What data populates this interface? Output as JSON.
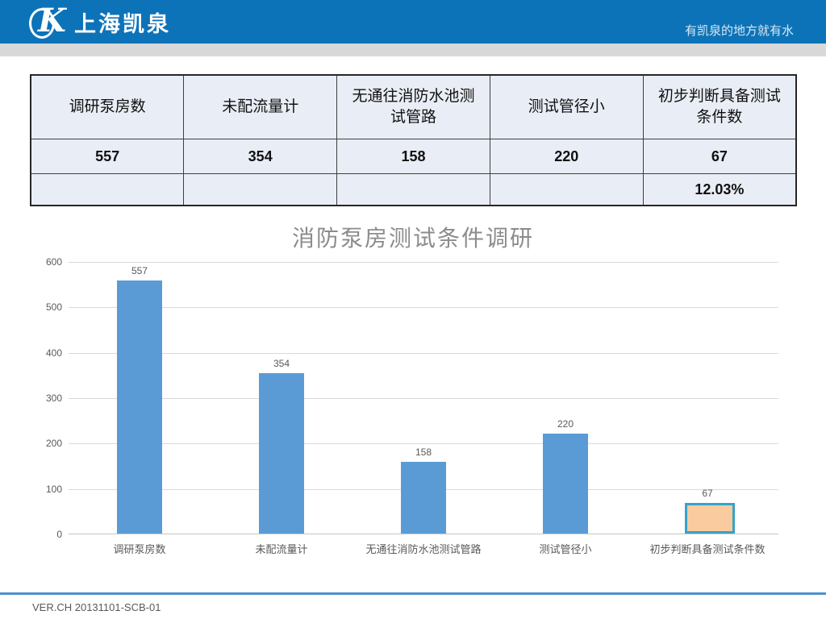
{
  "header": {
    "logo_text": "上海凯泉",
    "logo_glyph": "K",
    "slogan": "有凯泉的地方就有水",
    "brand_blue": "#0d73b8"
  },
  "table": {
    "columns": [
      "调研泵房数",
      "未配流量计",
      "无通往消防水池测试管路",
      "测试管径小",
      "初步判断具备测试条件数"
    ],
    "rows": [
      [
        "557",
        "354",
        "158",
        "220",
        "67"
      ],
      [
        "",
        "",
        "",
        "",
        "12.03%"
      ]
    ]
  },
  "chart_data": {
    "type": "bar",
    "title": "消防泵房测试条件调研",
    "categories": [
      "调研泵房数",
      "未配流量计",
      "无通往消防水池测试管路",
      "测试管径小",
      "初步判断具备测试条件数"
    ],
    "values": [
      557,
      354,
      158,
      220,
      67
    ],
    "data_labels": [
      "557",
      "354",
      "158",
      "220",
      "67"
    ],
    "xlabel": "",
    "ylabel": "",
    "ylim": [
      0,
      600
    ],
    "yticks": [
      0,
      100,
      200,
      300,
      400,
      500,
      600
    ],
    "grid": true,
    "legend": false,
    "bar_color": "#5b9bd5",
    "highlight_index": 4,
    "highlight_fill": "#f9cb9e",
    "highlight_border": "#35a3c8",
    "gridline_color": "#d9d9d9",
    "label_color": "#595959"
  },
  "footer": {
    "version_text": "VER.CH 20131101-SCB-01"
  }
}
